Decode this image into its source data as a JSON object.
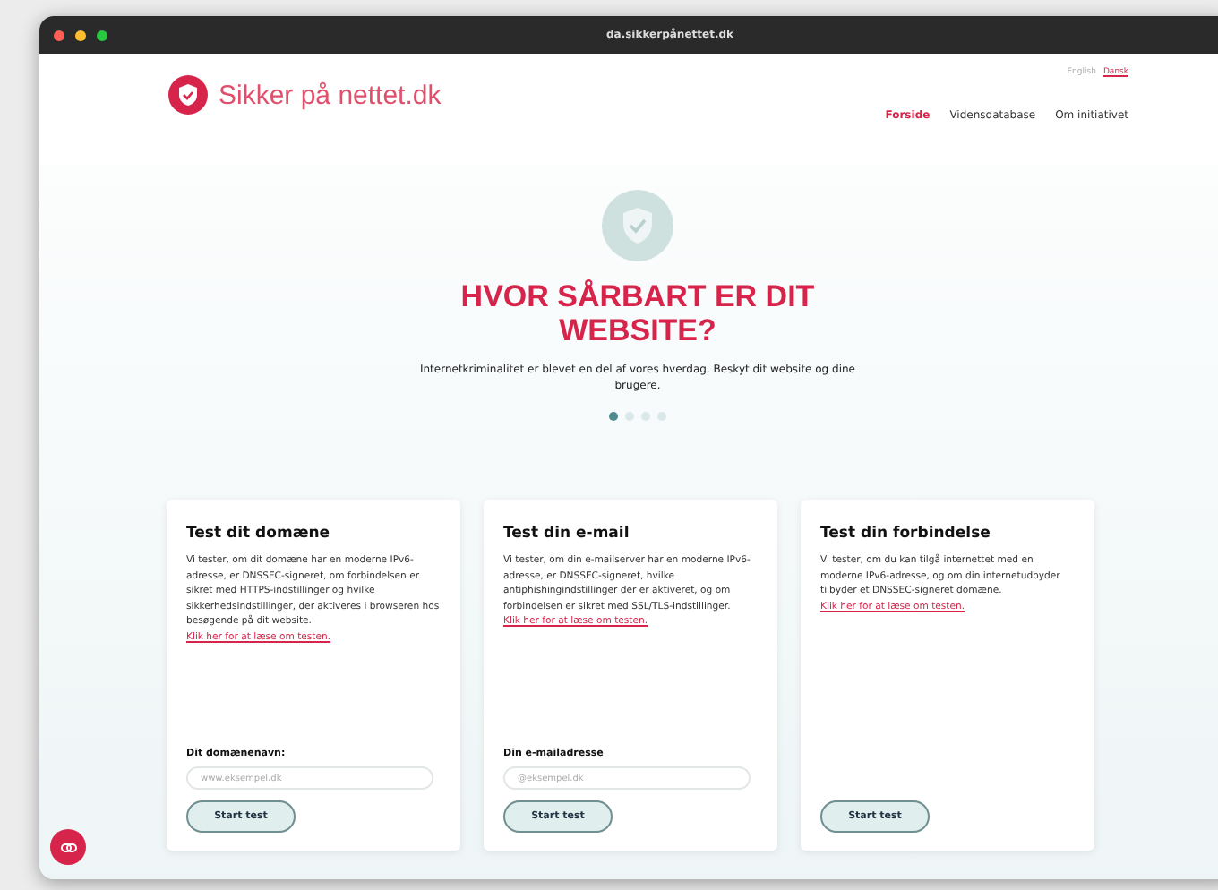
{
  "browser": {
    "url": "da.sikkerpånettet.dk"
  },
  "header": {
    "logo": "Sikker på nettet.dk",
    "languages": [
      {
        "label": "English",
        "selected": false
      },
      {
        "label": "Dansk",
        "selected": true
      }
    ],
    "nav": [
      {
        "label": "Forside",
        "selected": true
      },
      {
        "label": "Vidensdatabase",
        "selected": false
      },
      {
        "label": "Om initiativet",
        "selected": false
      }
    ]
  },
  "hero": {
    "title": "HVOR SÅRBART ER DIT WEBSITE?",
    "subtitle": "Internetkriminalitet er blevet en del af vores hverdag. Beskyt dit website og dine brugere.",
    "slides": [
      {
        "selected": true
      },
      {
        "selected": false
      },
      {
        "selected": false
      },
      {
        "selected": false
      }
    ]
  },
  "cards": [
    {
      "title": "Test dit domæne",
      "body": "Vi tester, om dit domæne har en moderne IPv6-adresse, er DNSSEC-signeret, om forbindelsen er sikret med HTTPS-indstillinger og hvilke sikkerhedsindstillinger, der aktiveres i browseren hos besøgende på dit website.",
      "link": "Klik her for at læse om testen.",
      "field_label": "Dit domænenavn:",
      "placeholder": "www.eksempel.dk",
      "button": "Start test"
    },
    {
      "title": "Test din e-mail",
      "body": "Vi tester, om din e-mailserver har en moderne IPv6-adresse, er DNSSEC-signeret, hvilke antiphishingindstillinger der er aktiveret, og om forbindelsen er sikret med SSL/TLS-indstillinger.",
      "link": "Klik her for at læse om testen.",
      "field_label": "Din e-mailadresse",
      "placeholder": "@eksempel.dk",
      "button": "Start test"
    },
    {
      "title": "Test din forbindelse",
      "body": "Vi tester, om du kan tilgå internettet med en moderne IPv6-adresse, og om din internetudbyder tilbyder et DNSSEC-signeret domæne.",
      "link": "Klik her for at læse om testen.",
      "button": "Start test"
    }
  ]
}
